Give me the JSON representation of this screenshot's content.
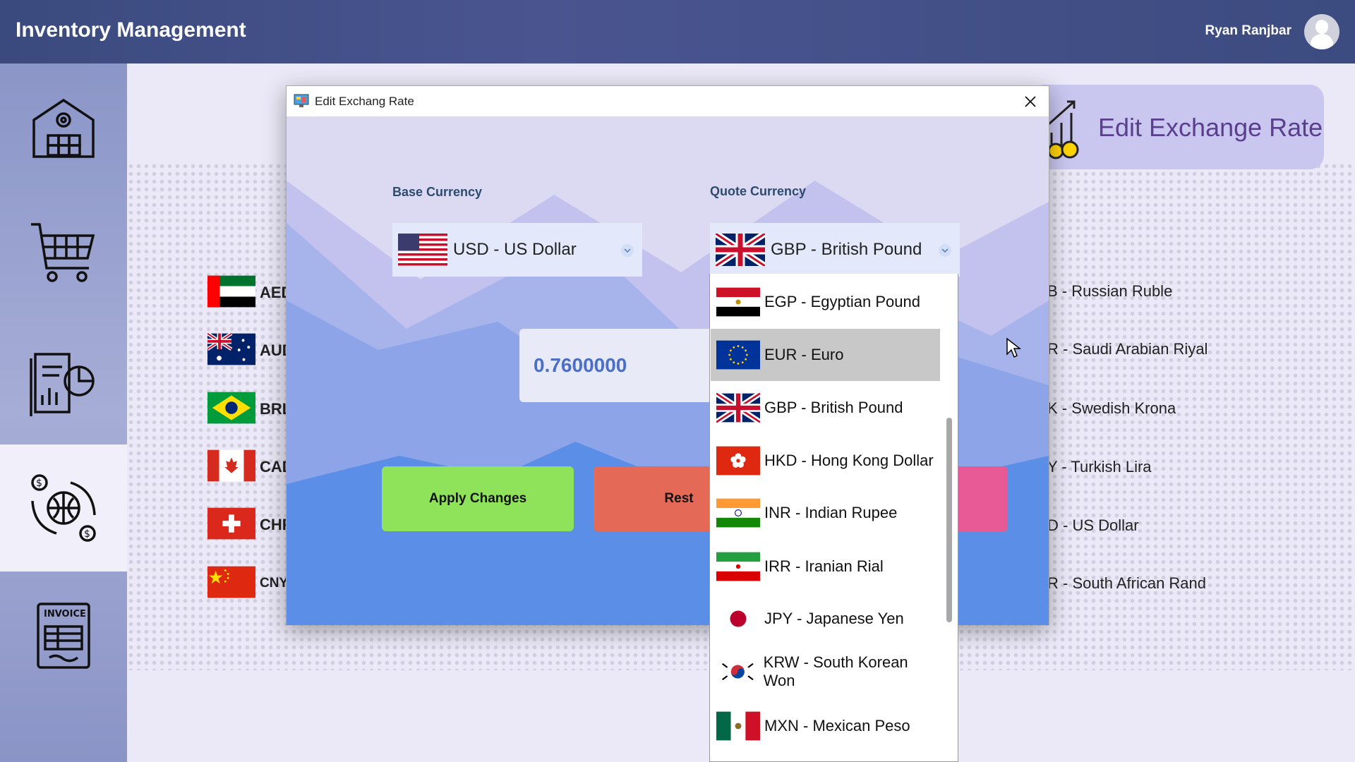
{
  "header": {
    "title": "Inventory Management",
    "user_name": "Ryan Ranjbar"
  },
  "sidebar": {
    "items": [
      {
        "icon": "warehouse-icon"
      },
      {
        "icon": "cart-icon"
      },
      {
        "icon": "reports-icon"
      },
      {
        "icon": "currency-exchange-icon",
        "active": true
      },
      {
        "icon": "invoice-icon",
        "label": "INVOICE"
      }
    ]
  },
  "page": {
    "title": "Edit Exchange Rate",
    "left_codes": [
      "AED",
      "AUD",
      "BRL",
      "CAD",
      "CHF",
      "CNY"
    ],
    "right_names": [
      "B - Russian Ruble",
      "R - Saudi Arabian Riyal",
      "K - Swedish Krona",
      "Y - Turkish Lira",
      "D - US Dollar",
      "R - South African Rand"
    ]
  },
  "dialog": {
    "title": "Edit Exchang Rate",
    "base_label": "Base Currency",
    "quote_label": "Quote Currency",
    "base_value": "USD - US Dollar",
    "quote_value": "GBP - British Pound",
    "rate": "0.7600000",
    "apply_label": "Apply Changes",
    "reset_label": "Rest"
  },
  "dropdown": {
    "options": [
      {
        "label": "EGP - Egyptian Pound",
        "selected": false
      },
      {
        "label": "EUR - Euro",
        "selected": true
      },
      {
        "label": "GBP - British Pound",
        "selected": false
      },
      {
        "label": "HKD - Hong Kong Dollar",
        "selected": false
      },
      {
        "label": "INR - Indian Rupee",
        "selected": false
      },
      {
        "label": "IRR - Iranian Rial",
        "selected": false
      },
      {
        "label": "JPY - Japanese Yen",
        "selected": false
      },
      {
        "label": "KRW - South Korean Won",
        "selected": false
      },
      {
        "label": "MXN - Mexican Peso",
        "selected": false
      }
    ]
  },
  "colors": {
    "header": "#3f4d85",
    "apply_button": "#8fe35a",
    "reset_button": "#e46a57",
    "pink_button": "#e75a95",
    "title_card": "#c9c6f0",
    "rate_text": "#4b6ec9"
  }
}
